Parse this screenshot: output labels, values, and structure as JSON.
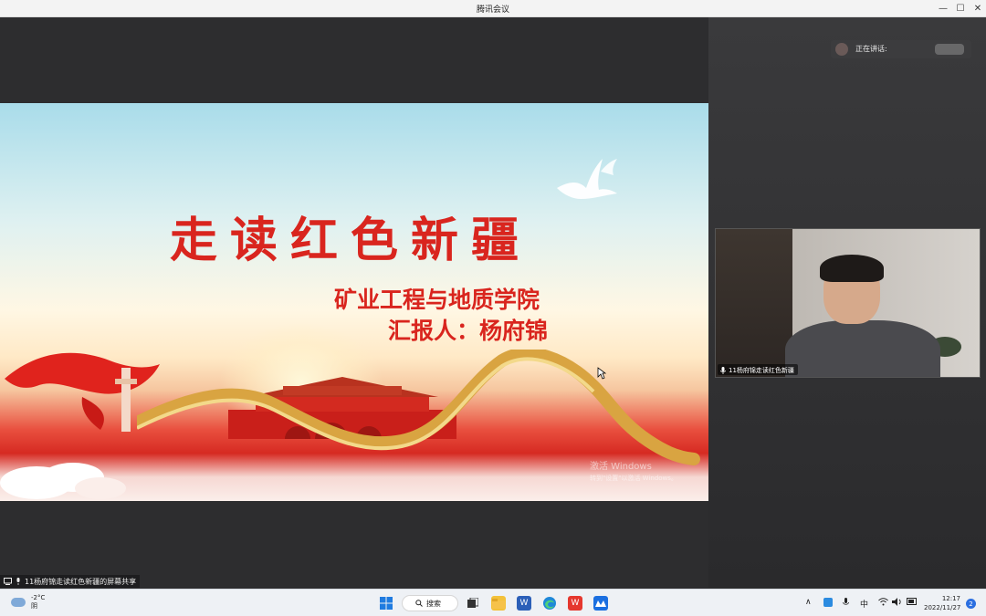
{
  "window": {
    "title": "腾讯会议"
  },
  "slide": {
    "title": "走读红色新疆",
    "line1": "矿业工程与地质学院",
    "line2": "汇报人：杨府锦",
    "watermark_line1": "激活 Windows",
    "watermark_line2": "转到\"设置\"以激活 Windows。"
  },
  "speaking": {
    "label": "正在讲话:"
  },
  "video": {
    "participant_name": "11杨府锦走读红色新疆"
  },
  "share_status": {
    "text": "11杨府锦走读红色新疆的屏幕共享"
  },
  "taskbar": {
    "weather_temp": "-2°C",
    "weather_desc": "阴",
    "search_label": "搜索",
    "ime": "中",
    "time": "12:17",
    "date": "2022/11/27",
    "notification_count": "2"
  },
  "colors": {
    "accent_red": "#d9251e",
    "taskbar_bg": "#eef1f5",
    "meeting_bg": "#2d2d2f"
  }
}
